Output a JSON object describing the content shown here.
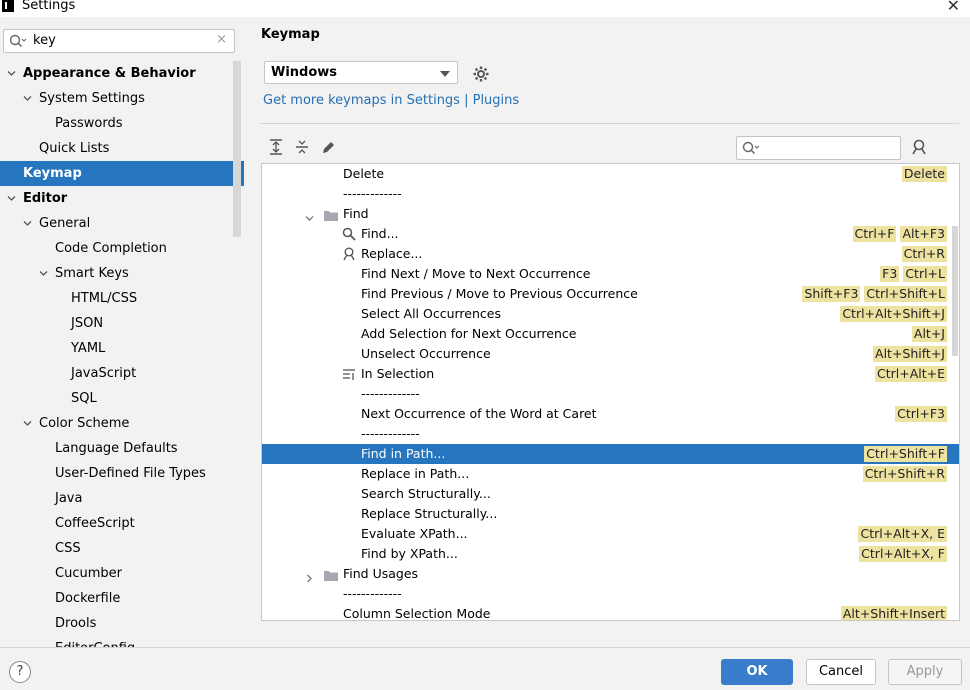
{
  "window": {
    "title": "Settings"
  },
  "sidebar": {
    "search_value": "key",
    "items": [
      {
        "label": "Appearance & Behavior",
        "level": 0,
        "expanded": true,
        "bold": true
      },
      {
        "label": "System Settings",
        "level": 1,
        "expanded": true
      },
      {
        "label": "Passwords",
        "level": 2
      },
      {
        "label": "Quick Lists",
        "level": 1
      },
      {
        "label": "Keymap",
        "level": 0,
        "bold": true,
        "selected": true
      },
      {
        "label": "Editor",
        "level": 0,
        "expanded": true,
        "bold": true
      },
      {
        "label": "General",
        "level": 1,
        "expanded": true
      },
      {
        "label": "Code Completion",
        "level": 2
      },
      {
        "label": "Smart Keys",
        "level": 2,
        "expanded": true
      },
      {
        "label": "HTML/CSS",
        "level": 3
      },
      {
        "label": "JSON",
        "level": 3
      },
      {
        "label": "YAML",
        "level": 3
      },
      {
        "label": "JavaScript",
        "level": 3
      },
      {
        "label": "SQL",
        "level": 3
      },
      {
        "label": "Color Scheme",
        "level": 1,
        "expanded": true
      },
      {
        "label": "Language Defaults",
        "level": 2
      },
      {
        "label": "User-Defined File Types",
        "level": 2
      },
      {
        "label": "Java",
        "level": 2
      },
      {
        "label": "CoffeeScript",
        "level": 2
      },
      {
        "label": "CSS",
        "level": 2
      },
      {
        "label": "Cucumber",
        "level": 2
      },
      {
        "label": "Dockerfile",
        "level": 2
      },
      {
        "label": "Drools",
        "level": 2
      },
      {
        "label": "EditorConfig",
        "level": 2
      }
    ]
  },
  "main": {
    "title": "Keymap",
    "keymap_select": "Windows",
    "link": "Get more keymaps in Settings | Plugins",
    "rows": [
      {
        "label": "Delete",
        "level": 1,
        "shortcuts": [
          "Delete"
        ]
      },
      {
        "label": "-------------",
        "level": 1,
        "shortcuts": []
      },
      {
        "label": "Find",
        "level": 1,
        "folder": true,
        "expanded": true,
        "shortcuts": []
      },
      {
        "label": "Find...",
        "level": 2,
        "icon": "search-icon",
        "shortcuts": [
          "Ctrl+F",
          "Alt+F3"
        ]
      },
      {
        "label": "Replace...",
        "level": 2,
        "icon": "replace-icon",
        "shortcuts": [
          "Ctrl+R"
        ]
      },
      {
        "label": "Find Next / Move to Next Occurrence",
        "level": 2,
        "shortcuts": [
          "F3",
          "Ctrl+L"
        ]
      },
      {
        "label": "Find Previous / Move to Previous Occurrence",
        "level": 2,
        "shortcuts": [
          "Shift+F3",
          "Ctrl+Shift+L"
        ]
      },
      {
        "label": "Select All Occurrences",
        "level": 2,
        "shortcuts": [
          "Ctrl+Alt+Shift+J"
        ]
      },
      {
        "label": "Add Selection for Next Occurrence",
        "level": 2,
        "shortcuts": [
          "Alt+J"
        ]
      },
      {
        "label": "Unselect Occurrence",
        "level": 2,
        "shortcuts": [
          "Alt+Shift+J"
        ]
      },
      {
        "label": "In Selection",
        "level": 2,
        "icon": "in-selection-icon",
        "shortcuts": [
          "Ctrl+Alt+E"
        ]
      },
      {
        "label": "-------------",
        "level": 2,
        "shortcuts": []
      },
      {
        "label": "Next Occurrence of the Word at Caret",
        "level": 2,
        "shortcuts": [
          "Ctrl+F3"
        ]
      },
      {
        "label": "-------------",
        "level": 2,
        "shortcuts": []
      },
      {
        "label": "Find in Path...",
        "level": 2,
        "selected": true,
        "shortcuts": [
          "Ctrl+Shift+F"
        ]
      },
      {
        "label": "Replace in Path...",
        "level": 2,
        "shortcuts": [
          "Ctrl+Shift+R"
        ]
      },
      {
        "label": "Search Structurally...",
        "level": 2,
        "shortcuts": []
      },
      {
        "label": "Replace Structurally...",
        "level": 2,
        "shortcuts": []
      },
      {
        "label": "Evaluate XPath...",
        "level": 2,
        "shortcuts": [
          "Ctrl+Alt+X, E"
        ]
      },
      {
        "label": "Find by XPath...",
        "level": 2,
        "shortcuts": [
          "Ctrl+Alt+X, F"
        ]
      },
      {
        "label": "Find Usages",
        "level": 1,
        "folder": true,
        "expanded": false,
        "shortcuts": []
      },
      {
        "label": "-------------",
        "level": 1,
        "shortcuts": []
      },
      {
        "label": "Column Selection Mode",
        "level": 1,
        "shortcuts": [
          "Alt+Shift+Insert"
        ]
      }
    ]
  },
  "footer": {
    "help_label": "?",
    "ok_label": "OK",
    "cancel_label": "Cancel",
    "apply_label": "Apply"
  },
  "colors": {
    "selection": "#2675bf",
    "shortcut_bg": "#ede2a0",
    "link": "#2470b3",
    "ok_button": "#3a7ccc"
  }
}
